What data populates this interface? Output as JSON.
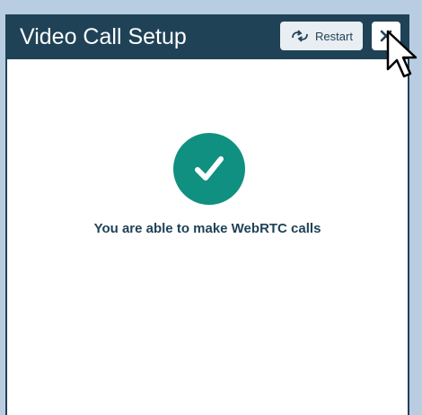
{
  "dialog": {
    "title": "Video Call Setup",
    "restart_label": "Restart",
    "status_message": "You are able to make WebRTC calls"
  },
  "icons": {
    "restart": "restart-arrows-icon",
    "close": "close-icon",
    "status": "checkmark-icon",
    "pointer": "mouse-pointer-icon"
  },
  "colors": {
    "background": "#b9cde2",
    "titlebar": "#1f4257",
    "success": "#0f9080",
    "button_bg": "#e9eef2"
  }
}
